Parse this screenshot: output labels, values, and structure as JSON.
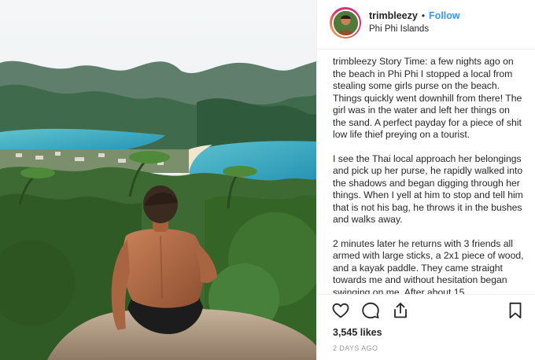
{
  "header": {
    "username": "trimbleezy",
    "separator": "•",
    "follow_label": "Follow",
    "location": "Phi Phi Islands"
  },
  "caption": {
    "username": "trimbleezy",
    "paragraphs": [
      "Story Time: a few nights ago on the beach in Phi Phi I stopped a local from stealing some girls purse on the beach. Things quickly went downhill from there! The girl was in the water and left her things on the sand. A perfect payday for a piece of shit low life thief preying on a tourist.",
      "I see the Thai local approach her belongings and pick up her purse, he rapidly walked into the shadows and began digging through her things. When I yell at him to stop and tell him that is not his bag, he throws it in the bushes and walks away.",
      "2 minutes later he returns with 3 friends all armed with large sticks, a 2x1 piece of wood, and a kayak paddle. They came straight towards me and without hesitation began swinging on me. After about 15"
    ]
  },
  "actions": {
    "like_icon": "heart-icon",
    "comment_icon": "comment-icon",
    "share_icon": "share-icon",
    "save_icon": "bookmark-icon"
  },
  "likes": "3,545 likes",
  "timestamp": "2 DAYS AGO",
  "colors": {
    "follow_blue": "#3897f0",
    "text": "#262626",
    "muted": "#999999",
    "border": "#efefef"
  }
}
